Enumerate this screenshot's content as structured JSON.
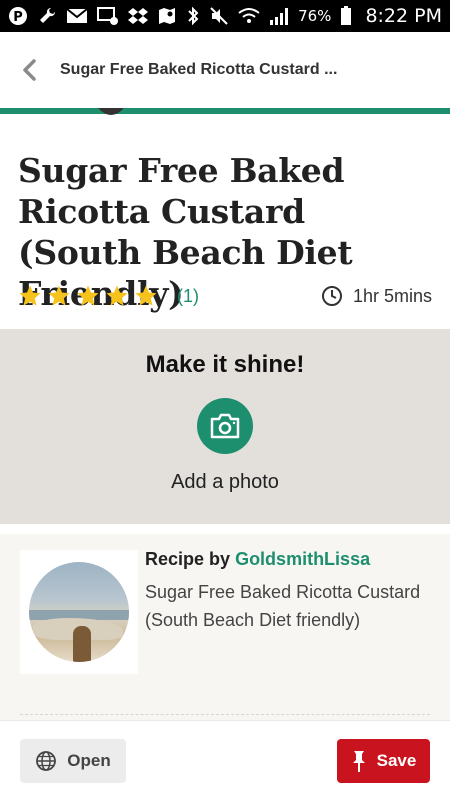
{
  "status_bar": {
    "battery_percent": "76%",
    "time": "8:22 PM",
    "icons": [
      "pinterest-icon",
      "wrench-icon",
      "mail-icon",
      "gallery-mail-icon",
      "dropbox-icon",
      "map-icon",
      "bluetooth-icon",
      "mute-icon",
      "wifi-icon",
      "signal-icon",
      "battery-icon"
    ]
  },
  "header": {
    "title": "Sugar Free Baked Ricotta Custard ...",
    "accent_color": "#1e8f6e"
  },
  "recipe": {
    "title": "Sugar Free Baked Ricotta Custard (South Beach Diet Friendly)",
    "rating": 5,
    "review_count": "(1)",
    "total_time": "1hr 5mins",
    "star_color": "#f6c21c"
  },
  "shine": {
    "heading": "Make it shine!",
    "add_photo_label": "Add a photo"
  },
  "author": {
    "prefix": "Recipe by",
    "name": "GoldsmithLissa",
    "description": "Sugar Free Baked Ricotta Custard (South Beach Diet friendly)"
  },
  "actions": {
    "open_label": "Open",
    "save_label": "Save",
    "save_color": "#c9141f"
  }
}
